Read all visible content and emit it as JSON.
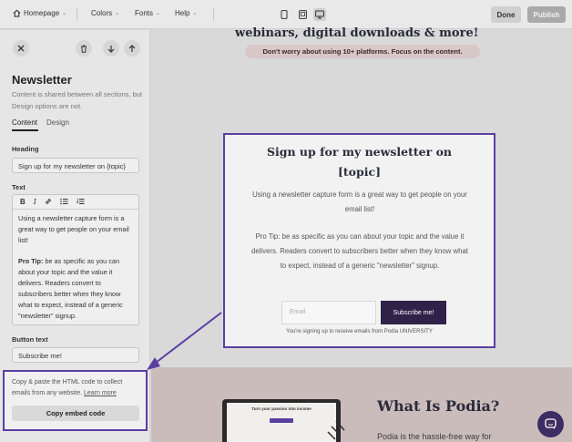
{
  "topbar": {
    "page_select": "Homepage",
    "menu": [
      "Colors",
      "Fonts",
      "Help"
    ],
    "done_label": "Done",
    "publish_label": "Publish"
  },
  "sidebar": {
    "title": "Newsletter",
    "description": "Content is shared between all sections, but Design options are not.",
    "tabs": [
      "Content",
      "Design"
    ],
    "heading_label": "Heading",
    "heading_value": "Sign up for my newsletter on {topic}",
    "text_label": "Text",
    "toolbar": [
      "B",
      "I",
      "🔗",
      "≔",
      "☷"
    ],
    "text_paragraph1": "Using a newsletter capture form is a great way to get people on your email list!",
    "text_protip_label": "Pro Tip:",
    "text_paragraph2": "be as specific as you can about your topic and the value it delivers. Readers convert to subscribers better when they know what to expect, instead of a generic \"newsletter\" signup.",
    "button_text_label": "Button text",
    "button_text_value": "Subscribe me!",
    "embed_text": "Copy & paste the HTML code to collect emails from any website.",
    "embed_link": "Learn more",
    "embed_button": "Copy embed code"
  },
  "canvas": {
    "hero_line": "webinars, digital downloads & more!",
    "hero_pill": "Don't worry about using 10+ platforms. Focus on the content.",
    "newsletter": {
      "title": "Sign up for my newsletter on [topic]",
      "paragraph1": "Using a newsletter capture form is a great way to get people on your email list!",
      "protip_label": "Pro Tip:",
      "paragraph2": "be as specific as you can about your topic and the value it delivers. Readers convert to subscribers better when they know what to expect, instead of a generic \"newsletter\" signup.",
      "email_placeholder": "Email",
      "subscribe_label": "Subscribe me!",
      "footer": "You're signing up to receive emails from Podia UNIVERSITY"
    },
    "laptop_title": "Turn your passion into income",
    "what_is_title": "What Is Podia?",
    "what_is_sub": "Podia is the hassle-free way for"
  },
  "colors": {
    "accent": "#5b3fa0",
    "button_dark": "#2f2248"
  }
}
